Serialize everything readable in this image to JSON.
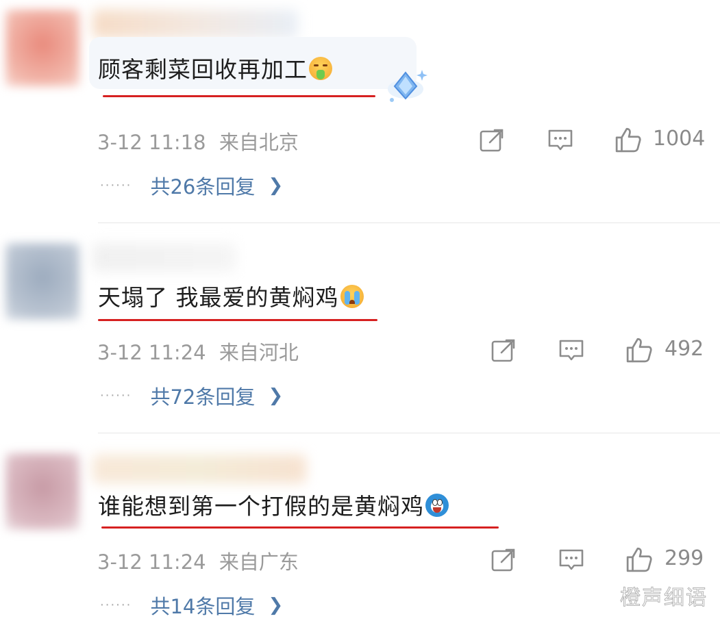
{
  "comments": [
    {
      "text": "顾客剩菜回收再加工",
      "emoji": "vomiting-face-emoji",
      "time": "3-12 11:18",
      "location": "来自北京",
      "likes": "1004",
      "replies": "共26条回复",
      "dots": "······"
    },
    {
      "text": "天塌了 我最爱的黄焖鸡",
      "emoji": "crying-face-emoji",
      "time": "3-12 11:24",
      "location": "来自河北",
      "likes": "492",
      "replies": "共72条回复",
      "dots": "······"
    },
    {
      "text": "谁能想到第一个打假的是黄焖鸡",
      "emoji": "doraemon-emoji",
      "time": "3-12 11:24",
      "location": "来自广东",
      "likes": "299",
      "replies": "共14条回复",
      "dots": "······"
    }
  ],
  "watermark": "橙声细语",
  "colors": {
    "underline": "#d62020",
    "reply_link": "#4f79a8",
    "meta": "#9a9a9a"
  }
}
